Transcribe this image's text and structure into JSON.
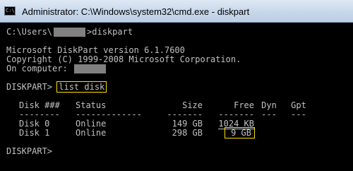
{
  "window": {
    "title": "Administrator: C:\\Windows\\system32\\cmd.exe - diskpart",
    "icon": "console-icon",
    "icon_glyph": "C:\\"
  },
  "console": {
    "prompt1_prefix": "C:\\Users\\",
    "prompt1_suffix": ">diskpart",
    "version_line": "Microsoft DiskPart version 6.1.7600",
    "copyright_line": "Copyright (C) 1999-2008 Microsoft Corporation.",
    "computer_label": "On computer: ",
    "cmd_prompt": "DISKPART> ",
    "cmd": "list disk",
    "final_prompt": "DISKPART>"
  },
  "disks": {
    "headers": {
      "disk": "Disk ###",
      "status": "Status",
      "size": "Size",
      "free": "Free",
      "dyn": "Dyn",
      "gpt": "Gpt"
    },
    "separators": {
      "disk": "--------",
      "status": "-------------",
      "size": "-------",
      "free": "-------",
      "dyn": "---",
      "gpt": "---"
    },
    "rows": [
      {
        "disk": "Disk 0",
        "status": "Online",
        "size": "149 GB",
        "free": "1024 KB",
        "dyn": "",
        "gpt": ""
      },
      {
        "disk": "Disk 1",
        "status": "Online",
        "size": "298 GB",
        "free": "9 GB",
        "dyn": "",
        "gpt": ""
      }
    ]
  },
  "colors": {
    "console_bg": "#000000",
    "console_text": "#c0c0c0",
    "highlight": "#ffe100",
    "redaction": "#808080"
  }
}
